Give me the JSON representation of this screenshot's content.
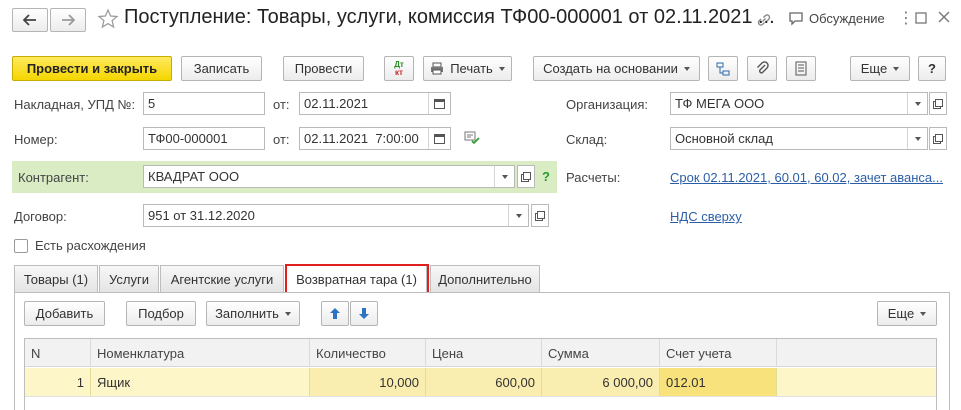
{
  "window": {
    "title": "Поступление: Товары, услуги, комиссия ТФ00-000001 от 02.11.2021 ...",
    "discuss_label": "Обсуждение"
  },
  "toolbar": {
    "post_close_label": "Провести и закрыть",
    "save_label": "Записать",
    "post_label": "Провести",
    "dtkt_label": "Дт/Кт",
    "dt_text": "Дт",
    "kt_text": "кт",
    "print_label": "Печать",
    "create_based_label": "Создать на основании",
    "more_label": "Еще",
    "help_label": "?"
  },
  "form": {
    "invoice_label": "Накладная, УПД №:",
    "invoice_value": "5",
    "from_label": "от:",
    "invoice_date": "02.11.2021",
    "number_label": "Номер:",
    "number_value": "ТФ00-000001",
    "number_from_label": "от:",
    "number_datetime": "02.11.2021  7:00:00",
    "org_label": "Организация:",
    "org_value": "ТФ МЕГА ООО",
    "warehouse_label": "Склад:",
    "warehouse_value": "Основной склад",
    "counterparty_label": "Контрагент:",
    "counterparty_value": "КВАДРАТ ООО",
    "counterparty_help": "?",
    "payments_label": "Расчеты:",
    "payments_link": "Срок 02.11.2021, 60.01, 60.02, зачет аванса...",
    "contract_label": "Договор:",
    "contract_value": "951 от 31.12.2020",
    "vat_link": "НДС сверху",
    "discrepancy_label": "Есть расхождения"
  },
  "tabs": [
    {
      "label": "Товары (1)"
    },
    {
      "label": "Услуги"
    },
    {
      "label": "Агентские услуги"
    },
    {
      "label": "Возвратная тара (1)"
    },
    {
      "label": "Дополнительно"
    }
  ],
  "table_toolbar": {
    "add_label": "Добавить",
    "select_label": "Подбор",
    "fill_label": "Заполнить",
    "more_label": "Еще"
  },
  "table": {
    "columns": [
      "N",
      "Номенклатура",
      "Количество",
      "Цена",
      "Сумма",
      "Счет учета"
    ],
    "rows": [
      {
        "n": "1",
        "item": "Ящик",
        "qty": "10,000",
        "price": "600,00",
        "sum": "6 000,00",
        "account": "012.01"
      }
    ]
  },
  "colors": {
    "accent_yellow": "#f5d600",
    "highlight_red": "#e0201f",
    "row_highlight": "#fdf6c8",
    "counterparty_bg": "#d9ecc4",
    "link": "#2b5ea7"
  }
}
